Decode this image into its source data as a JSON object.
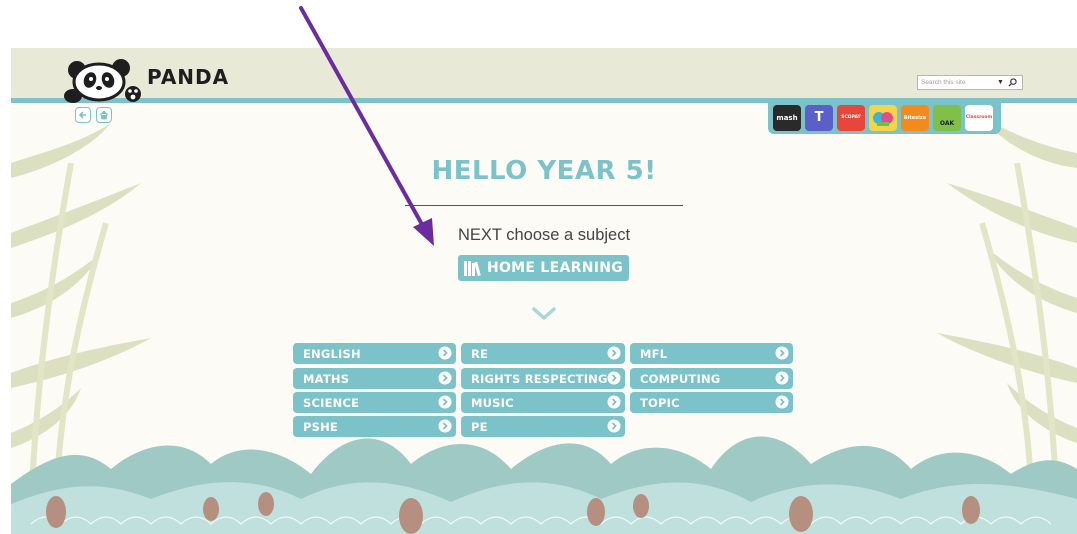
{
  "header": {
    "logo_text": "PANDA",
    "search_placeholder": "Search this site"
  },
  "apps": [
    {
      "name": "Purple Mash",
      "label": "mash",
      "color": "#2a2a2a"
    },
    {
      "name": "Teams",
      "label": "T",
      "color": "#5b5fc7"
    },
    {
      "name": "Scopay",
      "label": "SCOPAY",
      "color": "#e8463a"
    },
    {
      "name": "TTRockstars",
      "label": "",
      "color": "#f5d44a"
    },
    {
      "name": "BBC Bitesize",
      "label": "Bitesize",
      "color": "#f28a1e"
    },
    {
      "name": "Oak",
      "label": "OAK",
      "color": "#7fbf4a"
    },
    {
      "name": "Classroom Secrets",
      "label": "Classroom",
      "color": "#ffffff"
    }
  ],
  "main": {
    "title": "HELLO YEAR 5!",
    "subtitle": "NEXT choose a subject",
    "home_learning_label": "HOME LEARNING"
  },
  "subjects": [
    {
      "label": "ENGLISH"
    },
    {
      "label": "RE"
    },
    {
      "label": "MFL"
    },
    {
      "label": "MATHS"
    },
    {
      "label": "RIGHTS RESPECTING"
    },
    {
      "label": "COMPUTING"
    },
    {
      "label": "SCIENCE"
    },
    {
      "label": "MUSIC"
    },
    {
      "label": "TOPIC"
    },
    {
      "label": "PSHE"
    },
    {
      "label": "PE"
    }
  ],
  "colors": {
    "accent": "#7cc2c9",
    "header_bg": "#e8e9d6",
    "annotation": "#6a2c9e"
  }
}
